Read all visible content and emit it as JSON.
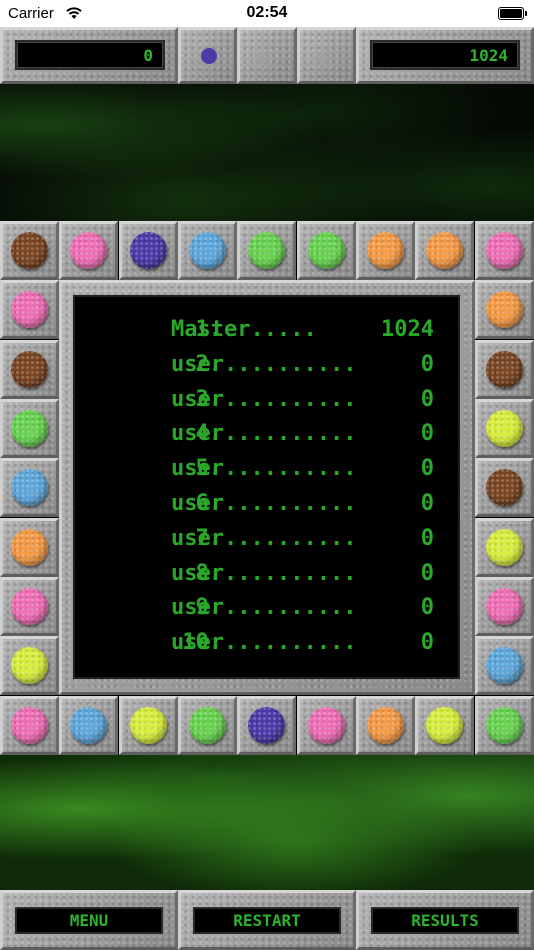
{
  "status_bar": {
    "carrier": "Carrier",
    "time": "02:54"
  },
  "top_bar": {
    "score": "0",
    "best": "1024",
    "next_ball_color": "#4b3aa8"
  },
  "colors": {
    "brown": "#7a4522",
    "pink": "#f06eb5",
    "purple": "#4b3aa8",
    "blue": "#5ea8dc",
    "green": "#68d34f",
    "orange": "#f59a45",
    "yellow": "#d8ee3c"
  },
  "board": {
    "top_row": [
      "brown",
      "pink",
      "purple",
      "blue",
      "green",
      "green",
      "orange",
      "orange",
      "pink"
    ],
    "left_col": [
      "pink",
      "brown",
      "green",
      "blue",
      "orange",
      "pink",
      "yellow"
    ],
    "right_col": [
      "orange",
      "brown",
      "yellow",
      "brown",
      "yellow",
      "pink",
      "blue"
    ],
    "bottom_row": [
      "pink",
      "blue",
      "yellow",
      "green",
      "purple",
      "pink",
      "orange",
      "yellow",
      "green"
    ]
  },
  "high_scores": [
    {
      "rank": "1.",
      "name": "Master",
      "dots": ".....",
      "score": "1024"
    },
    {
      "rank": "2.",
      "name": "user",
      "dots": "..........",
      "score": "0"
    },
    {
      "rank": "3.",
      "name": "user",
      "dots": "..........",
      "score": "0"
    },
    {
      "rank": "4.",
      "name": "user",
      "dots": "..........",
      "score": "0"
    },
    {
      "rank": "5.",
      "name": "user",
      "dots": "..........",
      "score": "0"
    },
    {
      "rank": "6.",
      "name": "user",
      "dots": "..........",
      "score": "0"
    },
    {
      "rank": "7.",
      "name": "user",
      "dots": "..........",
      "score": "0"
    },
    {
      "rank": "8.",
      "name": "user",
      "dots": "..........",
      "score": "0"
    },
    {
      "rank": "9.",
      "name": "user",
      "dots": "..........",
      "score": "0"
    },
    {
      "rank": "10.",
      "name": "user",
      "dots": "..........",
      "score": "0"
    }
  ],
  "bottom_bar": {
    "menu_label": "MENU",
    "restart_label": "RESTART",
    "results_label": "RESULTS"
  }
}
